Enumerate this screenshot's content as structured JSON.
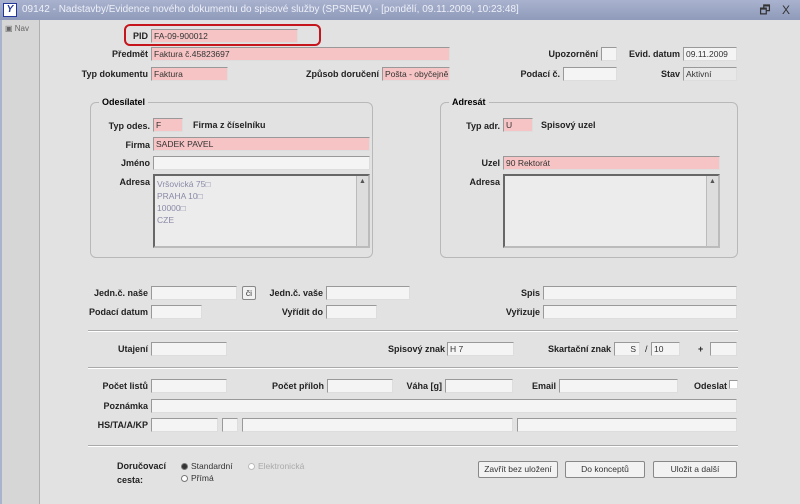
{
  "window": {
    "title": "09142 - Nadstavby/Evidence nového dokumentu do spisové služby (SPSNEW) - [pondělí, 09.11.2009, 10:23:48]",
    "controls": "🗗 X"
  },
  "sidebar": {
    "nav_label": "Nav"
  },
  "header": {
    "pid": {
      "label": "PID",
      "value": "FA-09-900012"
    },
    "predmet": {
      "label": "Předmět",
      "value": "Faktura č.45823697"
    },
    "typ_dokumentu": {
      "label": "Typ dokumentu",
      "value": "Faktura"
    },
    "zpusob_doruceni": {
      "label": "Způsob doručení",
      "value": "Pošta - obyčejně"
    },
    "upozorneni": {
      "label": "Upozornění",
      "value": ""
    },
    "evid_datum": {
      "label": "Evid. datum",
      "value": "09.11.2009"
    },
    "podaci_c": {
      "label": "Podací č.",
      "value": ""
    },
    "stav": {
      "label": "Stav",
      "value": "Aktivní"
    }
  },
  "sender": {
    "legend": "Odesílatel",
    "typ_label": "Typ odes.",
    "typ_value": "F",
    "typ_desc": "Firma z číselníku",
    "firma_label": "Firma",
    "firma_value": "SADEK PAVEL",
    "jmeno_label": "Jméno",
    "jmeno_value": "",
    "adresa_label": "Adresa",
    "adresa_lines": [
      "Vršovická 75□",
      "PRAHA 10□",
      "10000□",
      "CZE"
    ]
  },
  "recipient": {
    "legend": "Adresát",
    "typ_label": "Typ adr.",
    "typ_value": "U",
    "typ_desc": "Spisový uzel",
    "uzel_label": "Uzel",
    "uzel_value": "90 Rektorát",
    "adresa_label": "Adresa"
  },
  "refs": {
    "jedn_nase": "Jedn.č. naše",
    "ci_button": "či",
    "jedn_vase": "Jedn.č. vaše",
    "spis": "Spis",
    "podaci_datum": "Podací datum",
    "vyridit_do": "Vyřídit do",
    "vyrizuje": "Vyřizuje"
  },
  "classification": {
    "utajeni": "Utajení",
    "spisovy_znak_label": "Spisový znak",
    "spisovy_znak_value": "H 7",
    "skartacni_label": "Skartační znak",
    "skartacni_value": "S",
    "slash": "/",
    "lhuta": "10",
    "plus": "+"
  },
  "details": {
    "pocet_listu": "Počet listů",
    "pocet_priloh": "Počet příloh",
    "vaha": "Váha [g]",
    "email": "Email",
    "odeslat": "Odeslat",
    "poznamka": "Poznámka",
    "hs": "HS/TA/A/KP"
  },
  "delivery": {
    "label_line1": "Doručovací",
    "label_line2": "cesta:",
    "options": [
      "Standardní",
      "Elektronická",
      "Přímá"
    ]
  },
  "buttons": {
    "close": "Zavřít bez uložení",
    "draft": "Do konceptů",
    "save_next": "Uložit a další"
  }
}
